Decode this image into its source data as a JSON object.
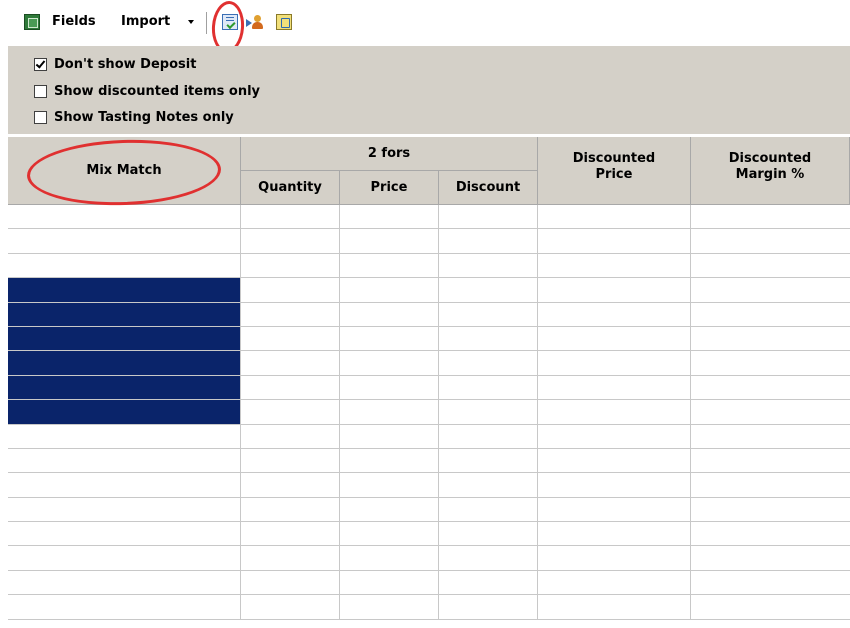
{
  "toolbar": {
    "fields_label": "Fields",
    "import_label": "Import",
    "icons": [
      "excel-export-icon",
      "checklist-icon",
      "assign-user-icon",
      "tasting-notes-icon"
    ]
  },
  "options": [
    {
      "label": "Don't show Deposit",
      "checked": true
    },
    {
      "label": "Show discounted items only",
      "checked": false
    },
    {
      "label": "Show Tasting Notes only",
      "checked": false
    }
  ],
  "grid": {
    "headers": {
      "mix_match": "Mix Match",
      "two_fors": "2 fors",
      "quantity": "Quantity",
      "price": "Price",
      "discount": "Discount",
      "discounted_price": "Discounted\nPrice",
      "discounted_margin": "Discounted\nMargin %"
    },
    "selected_rows": [
      3,
      4,
      5,
      6,
      7,
      8
    ]
  },
  "colors": {
    "selection": "#0a246a",
    "panel": "#d4d0c8",
    "annotation": "#e03030"
  }
}
